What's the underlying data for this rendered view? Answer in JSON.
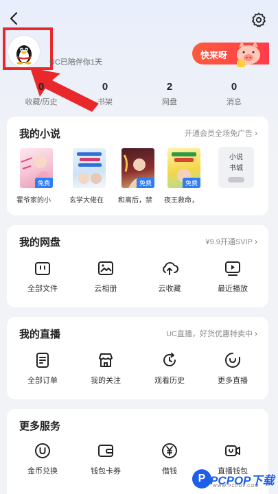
{
  "profile": {
    "companion_text": "UC已陪伴你1天",
    "vip_label": "快来呀"
  },
  "stats": [
    {
      "value": "0",
      "label": "收藏/历史"
    },
    {
      "value": "0",
      "label": "书架"
    },
    {
      "value": "2",
      "label": "网盘"
    },
    {
      "value": "0",
      "label": "消息"
    }
  ],
  "novels": {
    "title": "我的小说",
    "link": "开通会员全场免广告",
    "free_tag": "免费",
    "items": [
      {
        "title": "霍爷家的小"
      },
      {
        "title": "玄学大佬在"
      },
      {
        "title": "和离后，禁"
      },
      {
        "title": "夜王救命，"
      }
    ],
    "more_label_1": "小说",
    "more_label_2": "书城"
  },
  "cloud": {
    "title": "我的网盘",
    "link": "¥9.9开通SVIP",
    "items": [
      {
        "label": "全部文件",
        "icon": "folder-icon"
      },
      {
        "label": "云相册",
        "icon": "photo-icon"
      },
      {
        "label": "云收藏",
        "icon": "cloud-upload-icon"
      },
      {
        "label": "最近播放",
        "icon": "play-icon"
      }
    ]
  },
  "live": {
    "title": "我的直播",
    "link": "UC直播，好货优惠特卖中",
    "items": [
      {
        "label": "全部订单",
        "icon": "order-icon"
      },
      {
        "label": "我的关注",
        "icon": "store-icon"
      },
      {
        "label": "观看历史",
        "icon": "history-icon"
      },
      {
        "label": "更多直播",
        "icon": "camera-icon"
      }
    ]
  },
  "services": {
    "title": "更多服务",
    "items": [
      {
        "label": "金币兑换",
        "icon": "coin-icon"
      },
      {
        "label": "钱包卡券",
        "icon": "wallet-icon"
      },
      {
        "label": "借钱",
        "icon": "yen-icon"
      },
      {
        "label": "直播钱包",
        "icon": "live-wallet-icon"
      }
    ]
  },
  "watermark": {
    "logo": "P",
    "brand": "PCPOP下载",
    "sub": "WWW.PCPOP.COM"
  },
  "colors": {
    "accent": "#2f7cf6",
    "highlight": "#e8282b"
  }
}
